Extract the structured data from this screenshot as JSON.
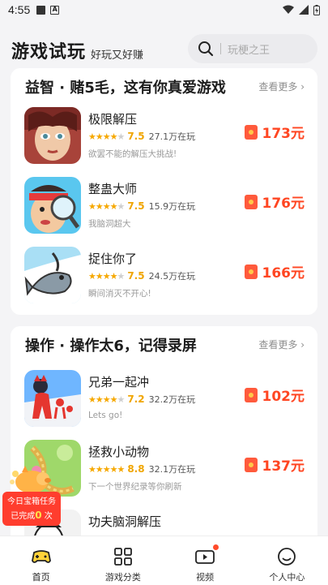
{
  "status": {
    "time": "4:55"
  },
  "header": {
    "brand": "游戏试玩",
    "tagline": "好玩又好赚",
    "search_placeholder": "玩梗之王"
  },
  "sections": [
    {
      "title": "益智 · 赌5毛，这有你真爱游戏",
      "more": "查看更多",
      "items": [
        {
          "name": "极限解压",
          "rating": "7.5",
          "stars": 3.5,
          "plays": "27.1万在玩",
          "desc": "欲罢不能的解压大挑战!",
          "reward": "173元"
        },
        {
          "name": "整蛊大师",
          "rating": "7.5",
          "stars": 3.5,
          "plays": "15.9万在玩",
          "desc": "我脑洞超大",
          "reward": "176元"
        },
        {
          "name": "捉住你了",
          "rating": "7.5",
          "stars": 3.5,
          "plays": "24.5万在玩",
          "desc": "瞬间消灭不开心!",
          "reward": "166元"
        }
      ]
    },
    {
      "title": "操作 · 操作太6，记得录屏",
      "more": "查看更多",
      "items": [
        {
          "name": "兄弟一起冲",
          "rating": "7.2",
          "stars": 3.5,
          "plays": "32.2万在玩",
          "desc": "Lets go!",
          "reward": "102元"
        },
        {
          "name": "拯救小动物",
          "rating": "8.8",
          "stars": 4.5,
          "plays": "32.1万在玩",
          "desc": "下一个世界纪录等你刷新",
          "reward": "137元"
        },
        {
          "name": "功夫脑洞解压",
          "rating": "",
          "stars": 0,
          "plays": "",
          "desc": "",
          "reward": ""
        }
      ]
    }
  ],
  "task": {
    "title": "今日宝箱任务",
    "done_prefix": "已完成",
    "count": "0",
    "unit": "次"
  },
  "nav": [
    {
      "label": "首页",
      "icon": "gamepad-icon",
      "active": true
    },
    {
      "label": "游戏分类",
      "icon": "grid-icon"
    },
    {
      "label": "视频",
      "icon": "video-icon"
    },
    {
      "label": "个人中心",
      "icon": "smile-icon"
    }
  ],
  "colors": {
    "accent": "#ff4622",
    "star": "#f6a800",
    "background": "#f4f4f6"
  }
}
